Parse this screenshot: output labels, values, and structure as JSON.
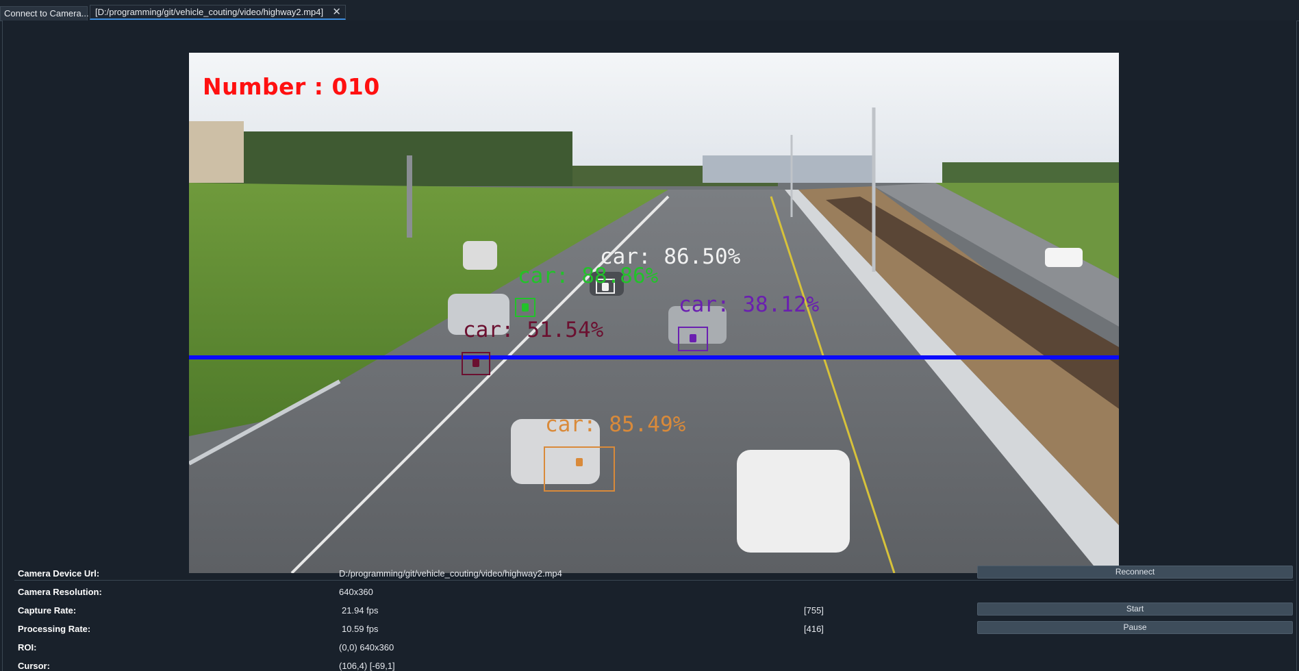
{
  "tabs": [
    {
      "label": "Connect to Camera..."
    },
    {
      "label": "[D:/programming/git/vehicle_couting/video/highway2.mp4]"
    }
  ],
  "video": {
    "counter_text": "Number : 010",
    "detections": [
      {
        "label": "car: 86.50%",
        "color": "#f2f2f2"
      },
      {
        "label": "car: 88.86%",
        "color": "#22c22a"
      },
      {
        "label": "car: 38.12%",
        "color": "#6a1fb0"
      },
      {
        "label": "car: 51.54%",
        "color": "#6b1030"
      },
      {
        "label": "car: 85.49%",
        "color": "#d98a3a"
      }
    ],
    "line_color": "#0a0aff"
  },
  "info": {
    "device_url": {
      "label": "Camera Device Url:",
      "value": "D:/programming/git/vehicle_couting/video/highway2.mp4"
    },
    "resolution": {
      "label": "Camera Resolution:",
      "value": "640x360"
    },
    "capture_rate": {
      "label": "Capture Rate:",
      "value": "21.94 fps",
      "extra": "[755]"
    },
    "processing_rate": {
      "label": "Processing Rate:",
      "value": "10.59 fps",
      "extra": "[416]"
    },
    "roi": {
      "label": "ROI:",
      "value": "(0,0) 640x360"
    },
    "cursor": {
      "label": "Cursor:",
      "value": "(106,4) [-69,1]"
    }
  },
  "buttons": {
    "reconnect": "Reconnect",
    "start": "Start",
    "pause": "Pause"
  },
  "colors": {
    "background": "#19212b",
    "tab_active_accent": "#3d8ee0",
    "button": "#3e4d5b",
    "counter": "#ff1010"
  }
}
